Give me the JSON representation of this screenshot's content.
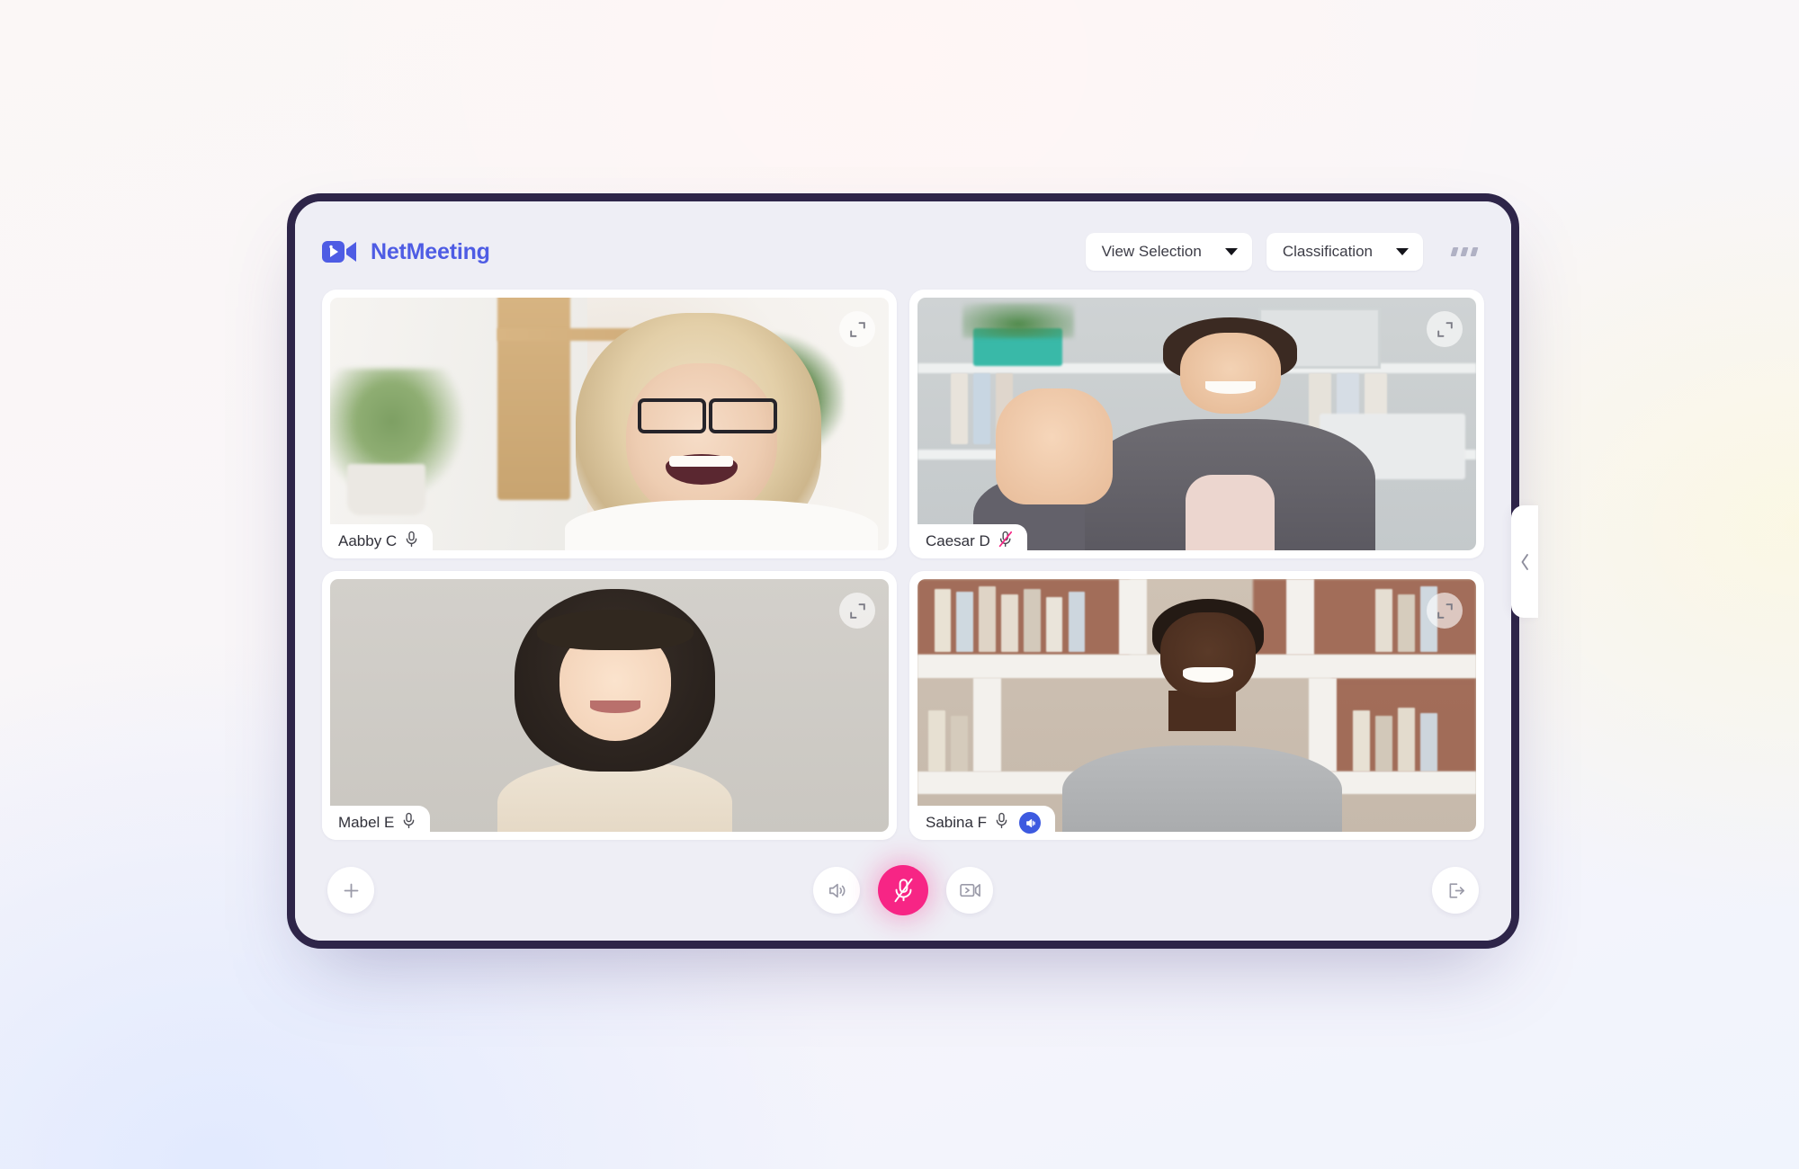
{
  "app": {
    "brand_name": "NetMeeting",
    "logo_icon": "video-camera-icon"
  },
  "header": {
    "view_selection": {
      "label": "View Selection",
      "icon": "chevron-down-icon"
    },
    "classification": {
      "label": "Classification",
      "icon": "chevron-down-icon"
    },
    "more_menu": {
      "icon": "more-options-icon"
    }
  },
  "participants": [
    {
      "name": "Aabby C",
      "mic_icon": "microphone-icon",
      "mic_muted": false,
      "has_speaker_badge": false,
      "expand_icon": "expand-icon"
    },
    {
      "name": "Caesar D",
      "mic_icon": "microphone-muted-icon",
      "mic_muted": true,
      "has_speaker_badge": false,
      "expand_icon": "expand-icon"
    },
    {
      "name": "Mabel E",
      "mic_icon": "microphone-icon",
      "mic_muted": false,
      "has_speaker_badge": false,
      "expand_icon": "expand-icon"
    },
    {
      "name": "Sabina F",
      "mic_icon": "microphone-icon",
      "mic_muted": false,
      "has_speaker_badge": true,
      "speaker_badge_icon": "speaker-icon",
      "expand_icon": "expand-icon"
    }
  ],
  "toolbar": {
    "add_participant": {
      "icon": "plus-icon",
      "label": ""
    },
    "speaker": {
      "icon": "speaker-icon",
      "label": ""
    },
    "microphone": {
      "icon": "microphone-muted-icon",
      "label": "",
      "active_muted": true
    },
    "share_video": {
      "icon": "video-share-icon",
      "label": ""
    },
    "leave_meeting": {
      "icon": "exit-icon",
      "label": ""
    }
  },
  "side_drawer": {
    "toggle_icon": "chevron-left-icon"
  },
  "colors": {
    "brand_blue": "#4e5ce4",
    "frame_dark": "#2e2549",
    "screen_bg": "#eeeef5",
    "mute_pink": "#f72585",
    "speaker_badge_blue": "#3d5ae0",
    "text_primary": "#31313a"
  }
}
